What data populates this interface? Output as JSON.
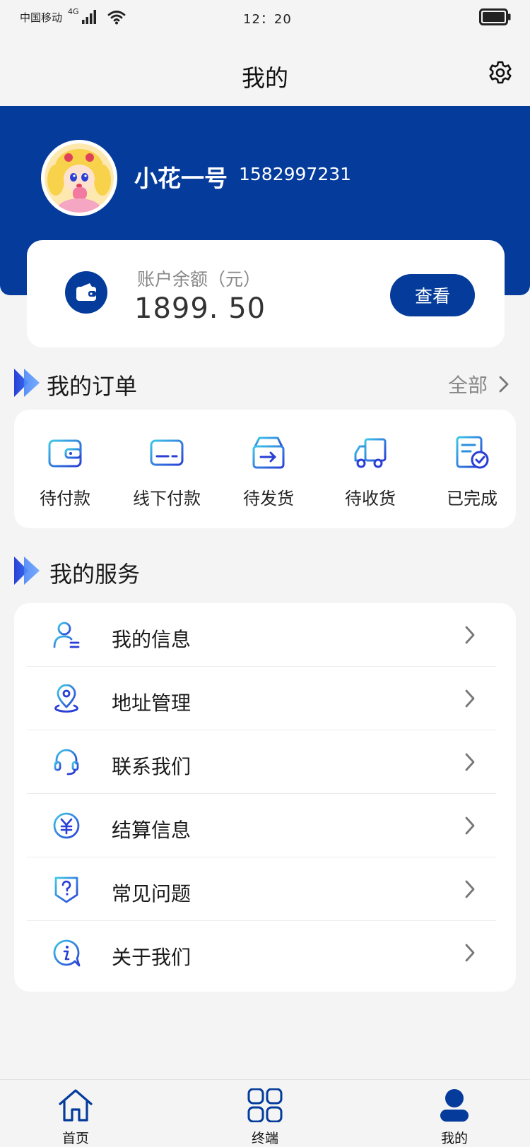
{
  "status_bar": {
    "carrier": "中国移动",
    "network": "4G",
    "time": "12：20"
  },
  "header": {
    "title": "我的",
    "settings_icon": "gear-icon"
  },
  "profile": {
    "name": "小花一号",
    "phone": "1582997231",
    "avatar_icon": "cartoon-avatar"
  },
  "balance": {
    "label": "账户余额（元）",
    "value": "1899. 50",
    "view_button": "查看",
    "icon": "wallet-icon"
  },
  "orders": {
    "title": "我的订单",
    "all_label": "全部",
    "items": [
      {
        "label": "待付款",
        "icon": "wallet-icon"
      },
      {
        "label": "线下付款",
        "icon": "card-icon"
      },
      {
        "label": "待发货",
        "icon": "box-arrow-icon"
      },
      {
        "label": "待收货",
        "icon": "truck-icon"
      },
      {
        "label": "已完成",
        "icon": "doc-check-icon"
      }
    ]
  },
  "services": {
    "title": "我的服务",
    "items": [
      {
        "label": "我的信息",
        "icon": "user-info-icon"
      },
      {
        "label": "地址管理",
        "icon": "location-pin-icon"
      },
      {
        "label": "联系我们",
        "icon": "headset-icon"
      },
      {
        "label": "结算信息",
        "icon": "yuan-coin-icon"
      },
      {
        "label": "常见问题",
        "icon": "question-shield-icon"
      },
      {
        "label": "关于我们",
        "icon": "info-bubble-icon"
      }
    ]
  },
  "tabbar": {
    "items": [
      {
        "label": "首页",
        "icon": "home-icon"
      },
      {
        "label": "终端",
        "icon": "grid-icon"
      },
      {
        "label": "我的",
        "icon": "person-icon",
        "active": true
      }
    ]
  },
  "colors": {
    "brand": "#053c9b",
    "icon_gradient_start": "#3ec8e8",
    "icon_gradient_end": "#2a3fd6",
    "background": "#f4f4f4"
  }
}
